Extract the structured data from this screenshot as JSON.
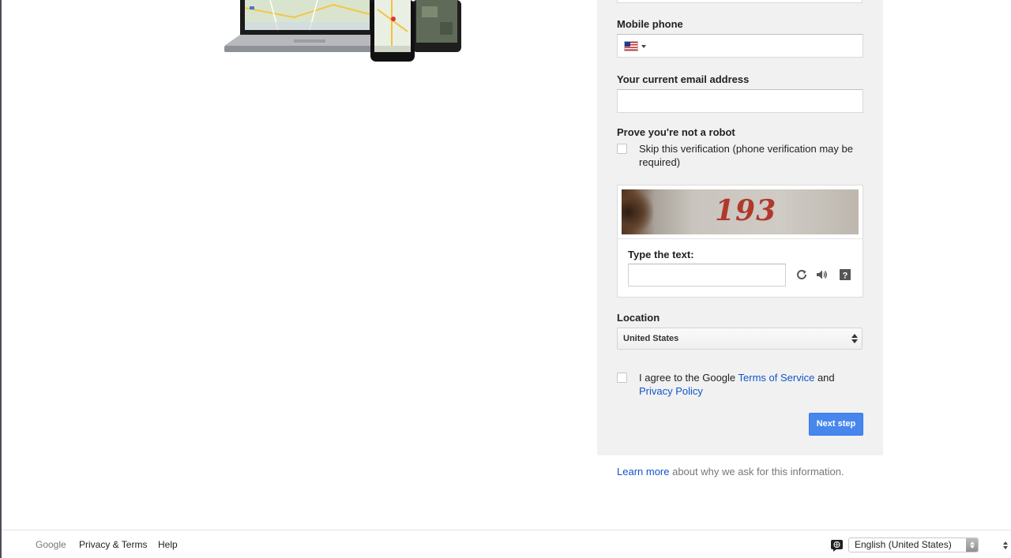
{
  "form": {
    "mobile_phone_label": "Mobile phone",
    "country_flag": "us-flag-icon",
    "email_label": "Your current email address",
    "email_value": "",
    "robot_label": "Prove you're not a robot",
    "skip_verification_text": "Skip this verification (phone verification may be required)",
    "captcha": {
      "code": "193",
      "type_label": "Type the text:",
      "value": "",
      "icons": [
        "refresh-icon",
        "audio-icon",
        "help-icon"
      ]
    },
    "location_label": "Location",
    "location_value": "United States",
    "agree_prefix": "I agree to the Google ",
    "terms_link": "Terms of Service",
    "agree_and": " and",
    "privacy_link": "Privacy Policy",
    "next_button": "Next step"
  },
  "learn_more": {
    "link": "Learn more",
    "text": " about why we ask for this information."
  },
  "footer": {
    "google": "Google",
    "privacy_terms": "Privacy & Terms",
    "help": "Help",
    "language": "English (United States)"
  },
  "colors": {
    "accent_button": "#4787ed",
    "link": "#1155cc",
    "panel_bg": "#f1f1f1"
  }
}
